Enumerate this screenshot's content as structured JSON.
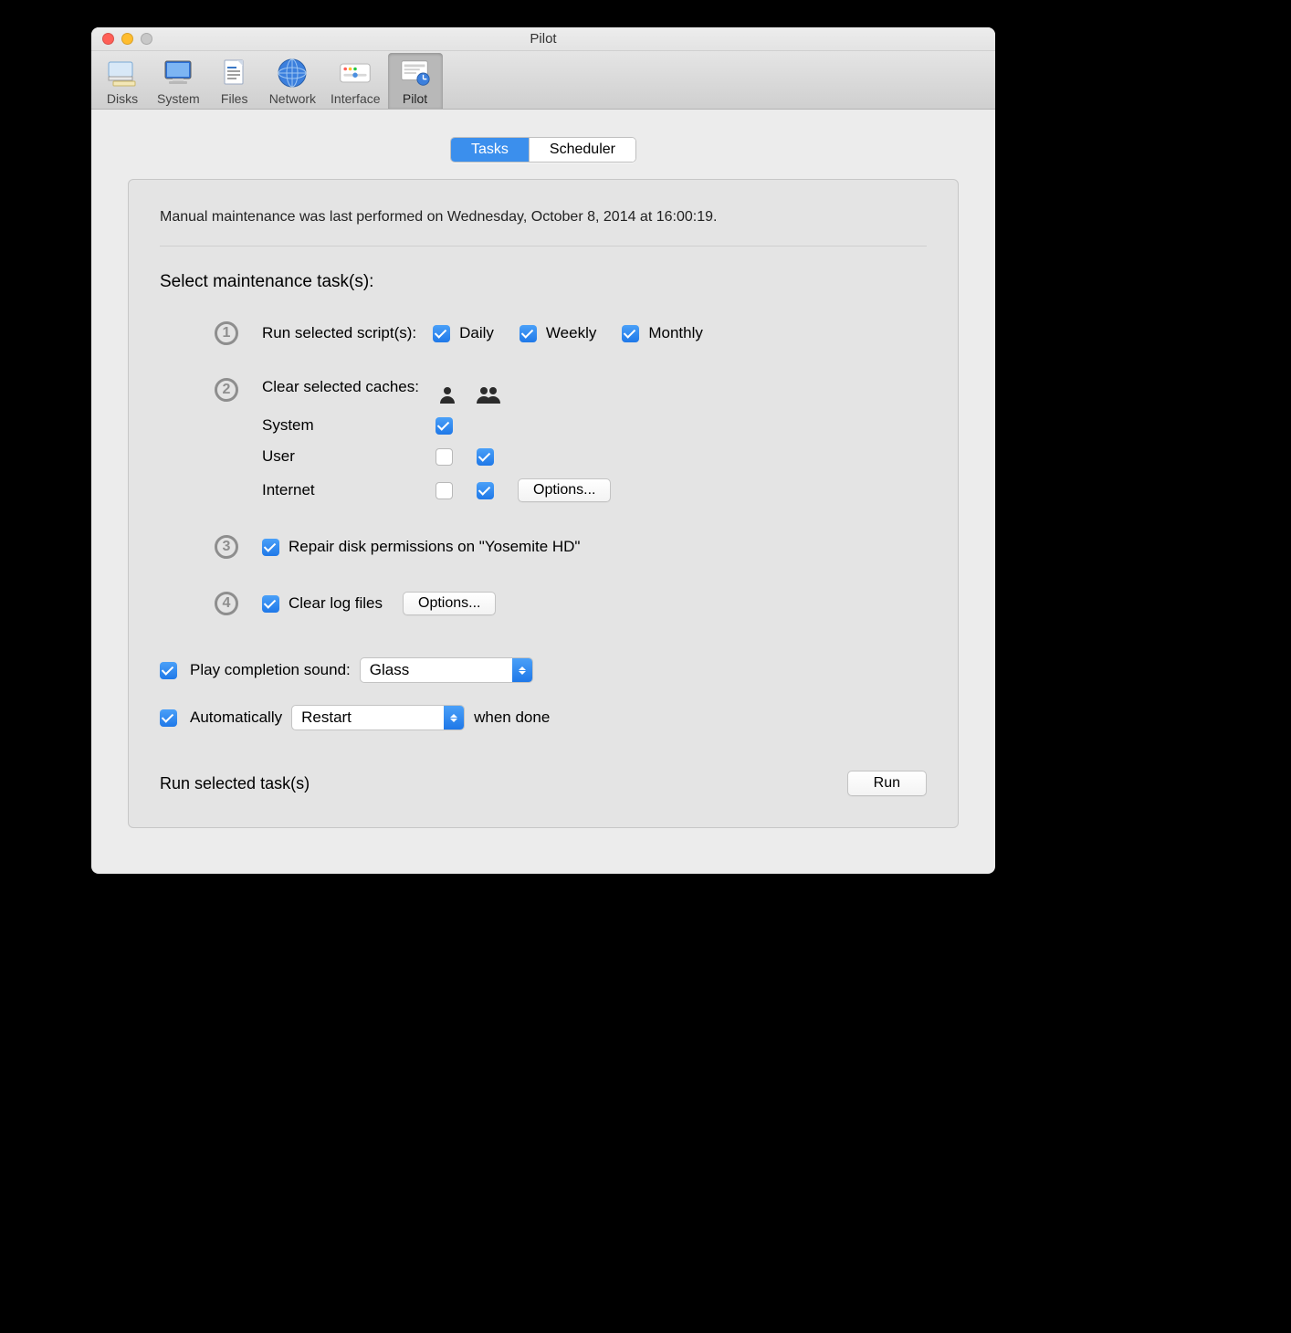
{
  "window": {
    "title": "Pilot"
  },
  "toolbar": {
    "items": [
      {
        "label": "Disks"
      },
      {
        "label": "System"
      },
      {
        "label": "Files"
      },
      {
        "label": "Network"
      },
      {
        "label": "Interface"
      },
      {
        "label": "Pilot"
      }
    ],
    "selected": 5
  },
  "tabs": {
    "tasks": "Tasks",
    "scheduler": "Scheduler",
    "active": "tasks"
  },
  "status_text": "Manual maintenance was last performed on Wednesday, October 8, 2014 at 16:00:19.",
  "section_title": "Select maintenance task(s):",
  "tasks": {
    "scripts": {
      "label": "Run selected script(s):",
      "daily": {
        "label": "Daily",
        "checked": true
      },
      "weekly": {
        "label": "Weekly",
        "checked": true
      },
      "monthly": {
        "label": "Monthly",
        "checked": true
      }
    },
    "caches": {
      "label": "Clear selected caches:",
      "rows": [
        {
          "label": "System",
          "single": true,
          "single_checked": true
        },
        {
          "label": "User",
          "col1": false,
          "col2": true
        },
        {
          "label": "Internet",
          "col1": false,
          "col2": true,
          "has_options": true
        }
      ],
      "options_label": "Options..."
    },
    "repair": {
      "label": "Repair disk permissions on \"Yosemite HD\"",
      "checked": true
    },
    "logs": {
      "label": "Clear log files",
      "checked": true,
      "options_label": "Options..."
    }
  },
  "completion_sound": {
    "enabled": true,
    "label": "Play completion sound:",
    "value": "Glass"
  },
  "auto_action": {
    "enabled": true,
    "label_before": "Automatically",
    "value": "Restart",
    "label_after": "when done"
  },
  "footer": {
    "label": "Run selected task(s)",
    "run_button": "Run"
  }
}
